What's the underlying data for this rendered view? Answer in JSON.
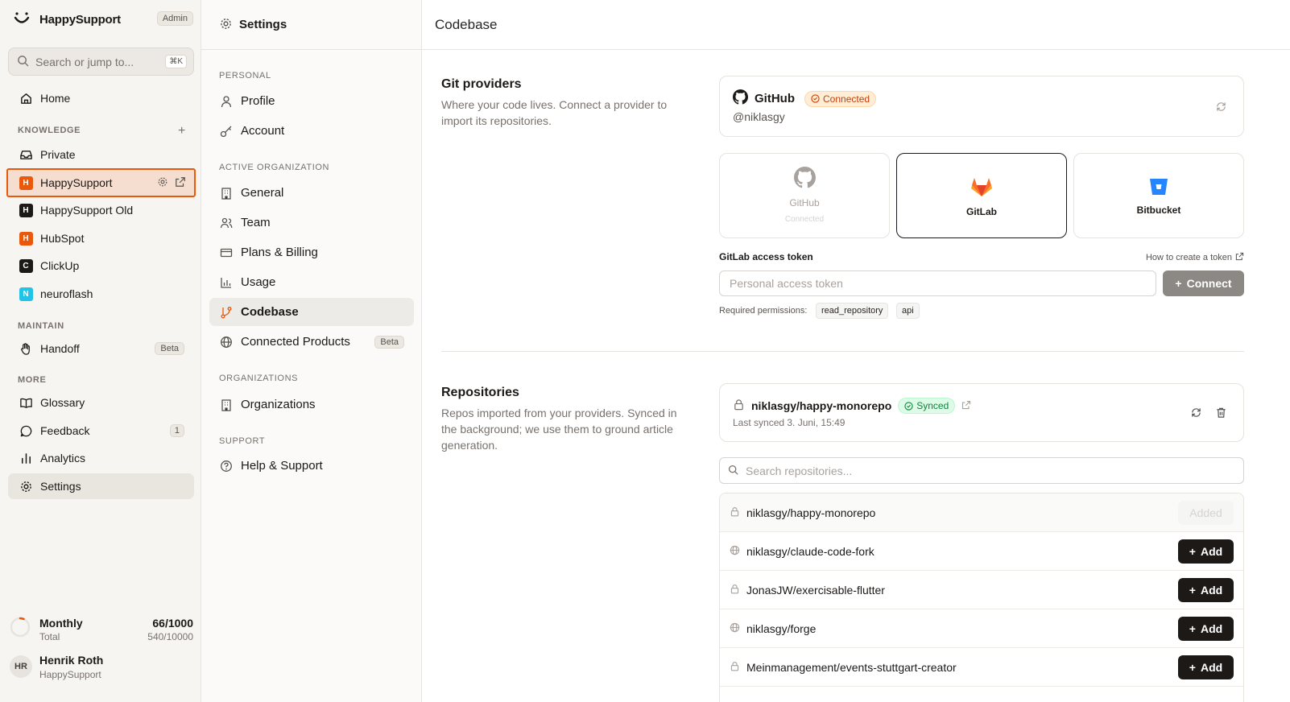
{
  "app": {
    "name": "HappySupport",
    "role_badge": "Admin"
  },
  "search": {
    "placeholder": "Search or jump to...",
    "shortcut": "⌘K"
  },
  "sidebar": {
    "home": "Home",
    "knowledge_label": "KNOWLEDGE",
    "private": "Private",
    "knowledge_bases": [
      {
        "initial": "H",
        "label": "HappySupport",
        "color": "#ea580c"
      },
      {
        "initial": "H",
        "label": "HappySupport Old",
        "color": "#1c1917"
      },
      {
        "initial": "H",
        "label": "HubSpot",
        "color": "#ea580c"
      },
      {
        "initial": "C",
        "label": "ClickUp",
        "color": "#1c1917"
      },
      {
        "initial": "N",
        "label": "neuroflash",
        "color": "#22c3e6"
      }
    ],
    "maintain_label": "MAINTAIN",
    "handoff": "Handoff",
    "handoff_badge": "Beta",
    "more_label": "MORE",
    "glossary": "Glossary",
    "feedback": "Feedback",
    "feedback_count": "1",
    "analytics": "Analytics",
    "settings": "Settings"
  },
  "usage": {
    "title": "Monthly",
    "subtitle": "Total",
    "value": "66/1000",
    "total": "540/10000",
    "fraction": 0.066
  },
  "user": {
    "initials": "HR",
    "name": "Henrik Roth",
    "org": "HappySupport"
  },
  "settings_nav": {
    "title": "Settings",
    "personal_label": "PERSONAL",
    "profile": "Profile",
    "account": "Account",
    "active_org_label": "ACTIVE ORGANIZATION",
    "general": "General",
    "team": "Team",
    "plans": "Plans & Billing",
    "usage": "Usage",
    "codebase": "Codebase",
    "connected_products": "Connected Products",
    "connected_badge": "Beta",
    "orgs_label": "ORGANIZATIONS",
    "organizations": "Organizations",
    "support_label": "SUPPORT",
    "help": "Help & Support"
  },
  "main": {
    "title": "Codebase",
    "git": {
      "title": "Git providers",
      "desc": "Where your code lives. Connect a provider to import its repositories.",
      "connected_name": "GitHub",
      "connected_status": "Connected",
      "connected_handle": "@niklasgy",
      "providers": [
        {
          "name": "GitHub",
          "sub": "Connected"
        },
        {
          "name": "GitLab",
          "sub": ""
        },
        {
          "name": "Bitbucket",
          "sub": ""
        }
      ],
      "token_label": "GitLab access token",
      "token_link": "How to create a token",
      "token_placeholder": "Personal access token",
      "connect_label": "Connect",
      "perm_label": "Required permissions:",
      "perms": [
        "read_repository",
        "api"
      ]
    },
    "repos": {
      "title": "Repositories",
      "desc": "Repos imported from your providers. Synced in the background; we use them to ground article generation.",
      "synced_name": "niklasgy/happy-monorepo",
      "synced_status": "Synced",
      "last_synced": "Last synced 3. Juni, 15:49",
      "search_placeholder": "Search repositories...",
      "list": [
        {
          "name": "niklasgy/happy-monorepo",
          "icon": "lock-icon",
          "action": "Added"
        },
        {
          "name": "niklasgy/claude-code-fork",
          "icon": "globe-icon",
          "action": "Add"
        },
        {
          "name": "JonasJW/exercisable-flutter",
          "icon": "lock-icon",
          "action": "Add"
        },
        {
          "name": "niklasgy/forge",
          "icon": "globe-icon",
          "action": "Add"
        },
        {
          "name": "Meinmanagement/events-stuttgart-creator",
          "icon": "lock-icon",
          "action": "Add"
        }
      ]
    }
  },
  "colors": {
    "accent": "#ea580c",
    "dark": "#1c1917",
    "sidebar_bg": "#f7f5f2"
  }
}
